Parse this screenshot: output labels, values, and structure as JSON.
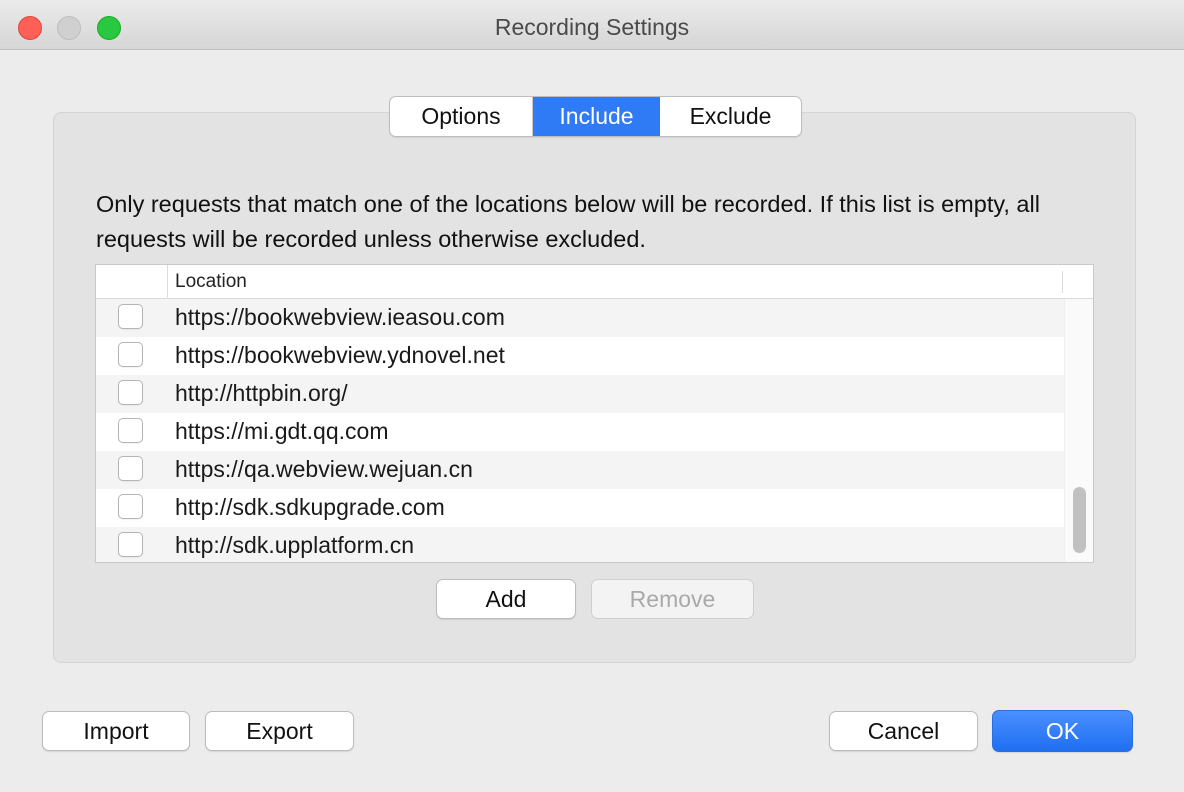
{
  "window": {
    "title": "Recording Settings"
  },
  "tabs": [
    {
      "label": "Options",
      "selected": false
    },
    {
      "label": "Include",
      "selected": true
    },
    {
      "label": "Exclude",
      "selected": false
    }
  ],
  "description": "Only requests that match one of the locations below will be recorded. If this list is empty, all requests will be recorded unless otherwise excluded.",
  "table": {
    "column_header": "Location",
    "rows": [
      {
        "checked": false,
        "location": "https://bookwebview.ieasou.com"
      },
      {
        "checked": false,
        "location": "https://bookwebview.ydnovel.net"
      },
      {
        "checked": false,
        "location": "http://httpbin.org/"
      },
      {
        "checked": false,
        "location": "https://mi.gdt.qq.com"
      },
      {
        "checked": false,
        "location": "https://qa.webview.wejuan.cn"
      },
      {
        "checked": false,
        "location": "http://sdk.sdkupgrade.com"
      },
      {
        "checked": false,
        "location": "http://sdk.upplatform.cn"
      }
    ]
  },
  "list_buttons": {
    "add": "Add",
    "remove": "Remove"
  },
  "footer": {
    "import": "Import",
    "export": "Export",
    "cancel": "Cancel",
    "ok": "OK"
  },
  "colors": {
    "accent": "#2f7bf5",
    "close": "#fe5f57",
    "maximize": "#28c940"
  }
}
